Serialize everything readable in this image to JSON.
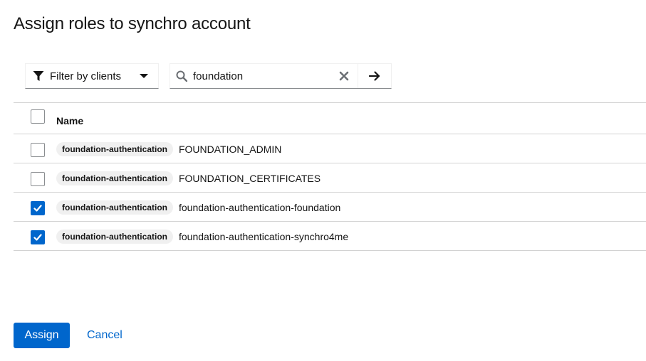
{
  "modal": {
    "title": "Assign roles to synchro account"
  },
  "toolbar": {
    "filter_label": "Filter by clients",
    "search": {
      "value": "foundation",
      "placeholder": ""
    }
  },
  "table": {
    "columns": [
      "Name"
    ],
    "rows": [
      {
        "client": "foundation-authentication",
        "role": "FOUNDATION_ADMIN",
        "checked": false
      },
      {
        "client": "foundation-authentication",
        "role": "FOUNDATION_CERTIFICATES",
        "checked": false
      },
      {
        "client": "foundation-authentication",
        "role": "foundation-authentication-foundation",
        "checked": true
      },
      {
        "client": "foundation-authentication",
        "role": "foundation-authentication-synchro4me",
        "checked": true
      }
    ]
  },
  "footer": {
    "assign_label": "Assign",
    "cancel_label": "Cancel"
  },
  "colors": {
    "primary": "#0066cc",
    "border": "#d2d2d2",
    "badge_bg": "#f0f0f0"
  },
  "icons": [
    "filter-icon",
    "caret-down-icon",
    "search-icon",
    "close-icon",
    "arrow-right-icon",
    "checkmark-icon"
  ]
}
